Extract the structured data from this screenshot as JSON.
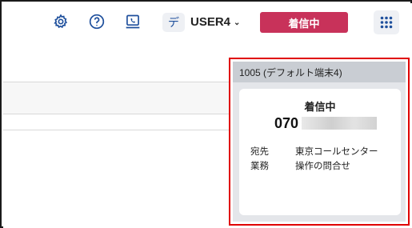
{
  "header": {
    "icons": [
      "gear-icon",
      "help-icon",
      "phone-screen-icon",
      "apps-grid-icon"
    ],
    "avatar_initial": "デ",
    "user_name": "USER4",
    "user_chevron": "⌄",
    "status_label": "着信中",
    "status_color": "#c8325a"
  },
  "call_panel": {
    "title": "1005 (デフォルト端末4)",
    "status": "着信中",
    "number_prefix": "070",
    "rows": [
      {
        "key": "宛先",
        "value": "東京コールセンター"
      },
      {
        "key": "業務",
        "value": "操作の問合せ"
      }
    ],
    "highlight_color": "#e00000"
  }
}
